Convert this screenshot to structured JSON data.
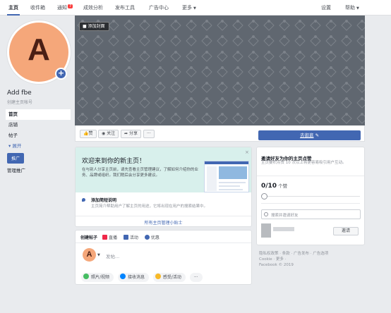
{
  "topnav": {
    "tabs": [
      {
        "label": "主页"
      },
      {
        "label": "收件箱"
      },
      {
        "label": "通知",
        "badge": "7"
      },
      {
        "label": "成效分析"
      },
      {
        "label": "发布工具"
      },
      {
        "label": "广告中心"
      },
      {
        "label": "更多"
      }
    ],
    "right": [
      {
        "label": "设置"
      },
      {
        "label": "帮助"
      }
    ]
  },
  "profile": {
    "initial": "A",
    "name": "Add fbe",
    "username_hint": "创建主页帐号",
    "avatar_color": "#f5a77a"
  },
  "sidebar": {
    "items": [
      {
        "label": "首页"
      },
      {
        "label": "店铺"
      },
      {
        "label": "帖子"
      },
      {
        "label": "展开"
      }
    ],
    "promote_label": "推广",
    "manage_label": "管理推广"
  },
  "cover": {
    "add_cover_label": "添加封面"
  },
  "actions": {
    "like": "赞",
    "follow": "关注",
    "share": "分享",
    "more": "···",
    "cta_label": "去逛逛",
    "accent": "#4267b2"
  },
  "welcome": {
    "title": "欢迎来到你的新主页！",
    "description": "在与别人分享主页前，请先查看主页管理建议，了解如何介绍你的业务、品牌或组织。我们稍后会分享更多建议。",
    "close": "×",
    "tip_title": "添加简短说明",
    "tip_desc": "主页简介帮助用户了解主页的用途，它将出现在用户的搜索结果中。",
    "tip_link": "所有主页管理小贴士"
  },
  "composer": {
    "tabs": [
      "创建帖子",
      "直播",
      "活动",
      "优惠"
    ],
    "initial": "A",
    "placeholder": "发帖...",
    "chips": [
      {
        "label": "照片/视频",
        "icon": "photo-icon",
        "color": "#45bd62"
      },
      {
        "label": "接收消息",
        "icon": "messenger-icon",
        "color": "#0084ff"
      },
      {
        "label": "感受/活动",
        "icon": "emoji-icon",
        "color": "#f7b928"
      }
    ],
    "more": "···"
  },
  "invite": {
    "title": "邀请好友为你的主页点赞",
    "subtitle": "主页要积点赞 10 次以上将更容易吸引用户互动。",
    "count": "0/10",
    "count_suffix": "个赞",
    "search_placeholder": "搜索并邀请好友",
    "invite_button": "邀请"
  },
  "footer": {
    "lines": [
      "隐私权政策 · 条款 · 广告发布 · 广告选项",
      "Cookie · 更多 ·",
      "Facebook © 2019"
    ]
  }
}
